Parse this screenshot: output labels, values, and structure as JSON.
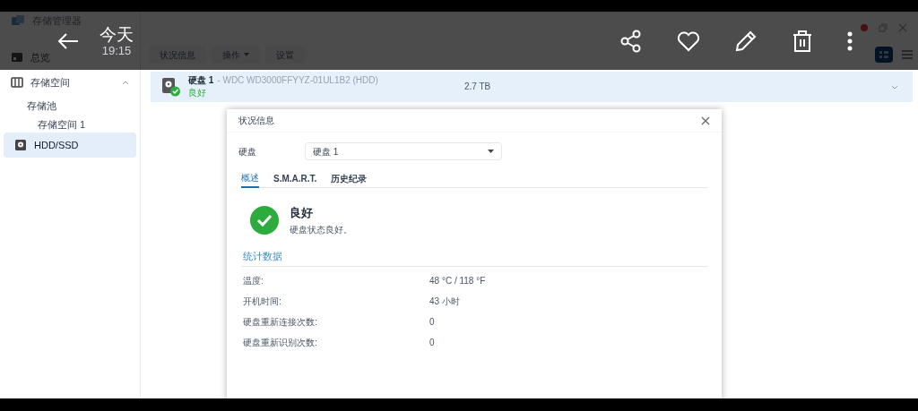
{
  "viewer": {
    "date": "今天",
    "time": "19:15"
  },
  "app": {
    "title": "存储管理器",
    "sidebar": {
      "items": [
        {
          "label": "总览",
          "selected": false
        },
        {
          "label": "存储空间",
          "selected": false,
          "expanded": true,
          "children": [
            {
              "label": "存储池",
              "selected": false,
              "children": [
                {
                  "label": "存储空间 1",
                  "selected": false
                }
              ]
            }
          ]
        },
        {
          "label": "HDD/SSD",
          "selected": true
        }
      ]
    },
    "toolbar": [
      {
        "label": "状况信息",
        "kind": "button"
      },
      {
        "label": "操作",
        "kind": "menu"
      },
      {
        "label": "设置",
        "kind": "button"
      }
    ],
    "disks": [
      {
        "name": "硬盘 1",
        "model": "- WDC WD3000FFYYZ-01UL1B2 (HDD)",
        "status": "良好",
        "capacity": "2.7 TB",
        "selected": true,
        "expanded": false
      }
    ],
    "dialog": {
      "title": "状况信息",
      "field": {
        "label": "硬盘",
        "value": "硬盘 1"
      },
      "tabs": [
        {
          "label": "概述",
          "selected": true
        },
        {
          "label": "S.M.A.R.T.",
          "selected": false
        },
        {
          "label": "历史纪录",
          "selected": false
        }
      ],
      "status": {
        "title": "良好",
        "description": "硬盘状态良好。"
      },
      "section": "统计数据",
      "rows": [
        {
          "label": "温度:",
          "value": "48 °C / 118 °F"
        },
        {
          "label": "开机时间:",
          "value": "43 小时"
        },
        {
          "label": "硬盘重新连接次数:",
          "value": "0"
        },
        {
          "label": "硬盘重新识别次数:",
          "value": "0"
        }
      ]
    }
  }
}
